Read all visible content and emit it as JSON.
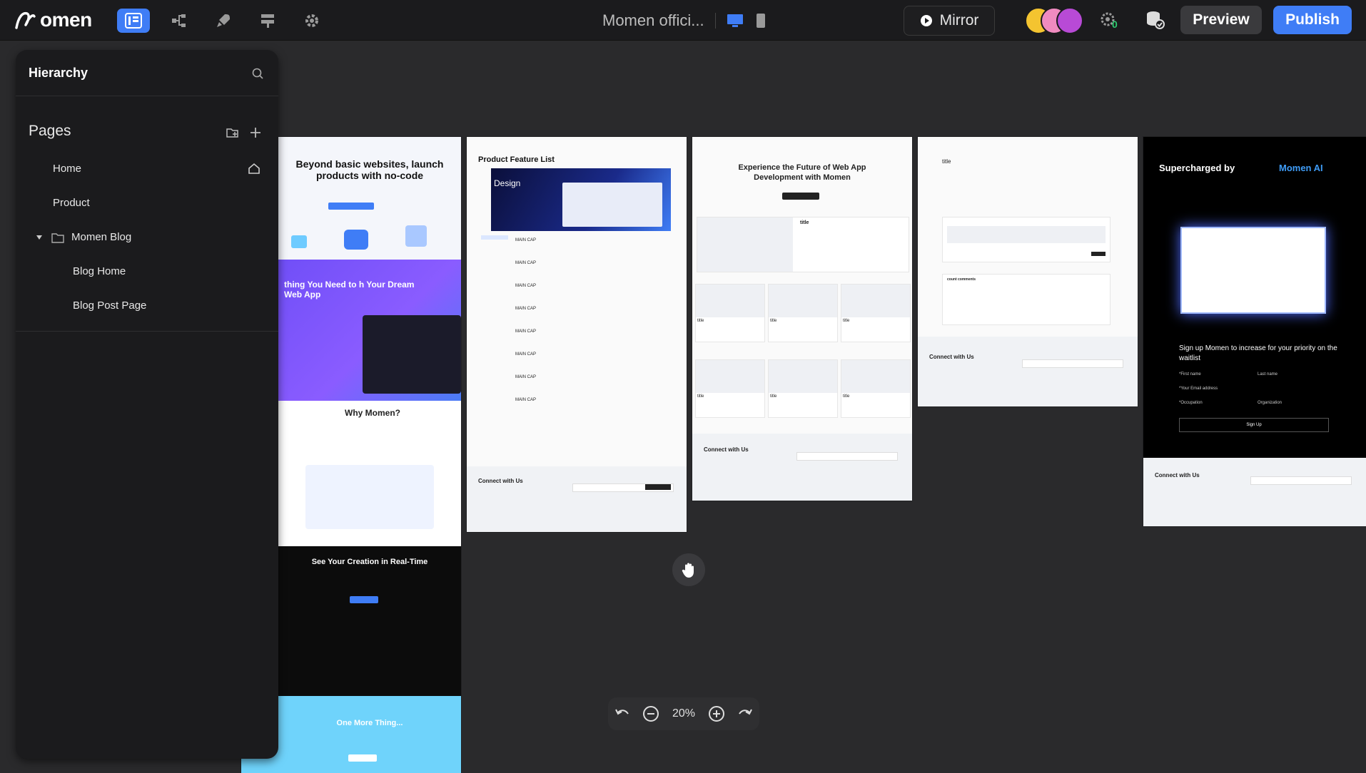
{
  "app": {
    "logo_text": "omen",
    "logo_mark": "ↄ"
  },
  "topbar": {
    "doc_title": "Momen offici...",
    "mirror_label": "Mirror",
    "preview_label": "Preview",
    "publish_label": "Publish",
    "badge_count": "0",
    "accent_color": "#3f7df6"
  },
  "sidebar": {
    "title": "Hierarchy",
    "pages_heading": "Pages",
    "pages": [
      {
        "label": "Home"
      },
      {
        "label": "Product"
      },
      {
        "label": "Momen Blog"
      },
      {
        "label": "Blog Home"
      },
      {
        "label": "Blog Post Page"
      }
    ]
  },
  "canvas": {
    "zoom": "20%",
    "thumbs": {
      "home": {
        "h1": "Beyond basic websites, launch products with no-code",
        "h2": "thing You Need to h Your Dream Web App",
        "h3": "Why Momen?",
        "h4": "See Your Creation in Real-Time",
        "h5": "One More Thing..."
      },
      "product": {
        "title": "Product Feature List",
        "design": "Design",
        "row_label": "MAIN CAP",
        "connect": "Connect with Us"
      },
      "blog": {
        "title": "Experience the Future of Web App Development with Momen",
        "card_title": "title",
        "connect": "Connect with Us"
      },
      "post": {
        "title": "title",
        "comments": "count comments",
        "connect": "Connect with Us"
      },
      "ai": {
        "title": "Supercharged by",
        "title_accent": "Momen AI",
        "signup": "Sign up Momen to increase for your priority on the waitlist",
        "connect": "Connect with Us",
        "first_name": "*First name",
        "last_name": "Last name",
        "email": "*Your Email address",
        "occupation": "*Occupation",
        "organization": "Organization",
        "sign_up": "Sign Up"
      }
    }
  }
}
